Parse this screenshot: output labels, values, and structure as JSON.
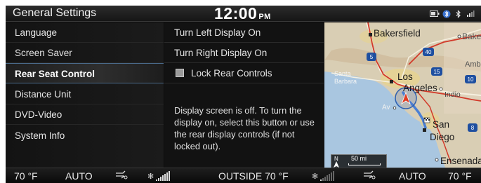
{
  "header": {
    "title": "General Settings",
    "time": "12:00",
    "ampm": "PM",
    "icons": [
      "battery-icon",
      "phone-bluetooth-icon",
      "bluetooth-icon",
      "signal-icon"
    ]
  },
  "menu": {
    "items": [
      {
        "label": "Language"
      },
      {
        "label": "Screen Saver"
      },
      {
        "label": "Rear Seat Control"
      },
      {
        "label": "Distance Unit"
      },
      {
        "label": "DVD-Video"
      },
      {
        "label": "System Info"
      }
    ],
    "selected": "Rear Seat Control"
  },
  "panel": {
    "turn_left": "Turn Left Display On",
    "turn_right": "Turn Right Display On",
    "lock_label": "Lock Rear Controls",
    "lock_checked": false,
    "info": "Display screen is off. To turn the display on, select this button or use the rear display controls (if not locked out)."
  },
  "map": {
    "labels": {
      "bakersfield": "Bakersfield",
      "baker": "Baker",
      "amb": "Amb",
      "santa_barbara_1": "Santa",
      "santa_barbara_2": "Barbara",
      "los": "Los",
      "angeles": "Angeles",
      "indio": "Indio",
      "av": "Av",
      "san": "San",
      "diego": "Diego",
      "ensenada": "Ensenada"
    },
    "highway_shields": [
      "5",
      "40",
      "15",
      "10",
      "8"
    ],
    "scale_label": "50 mi",
    "compass": "N",
    "colors": {
      "land": "#d9ceb4",
      "water": "#a9c6e0",
      "route": "#4a7fd4",
      "highway": "#d23a2a"
    }
  },
  "climate": {
    "left_temp": "70 °F",
    "left_mode": "AUTO",
    "outside": "OUTSIDE  70 °F",
    "right_mode": "AUTO",
    "right_temp": "70 °F",
    "left_fan_level": 5,
    "right_fan_level": 1
  }
}
